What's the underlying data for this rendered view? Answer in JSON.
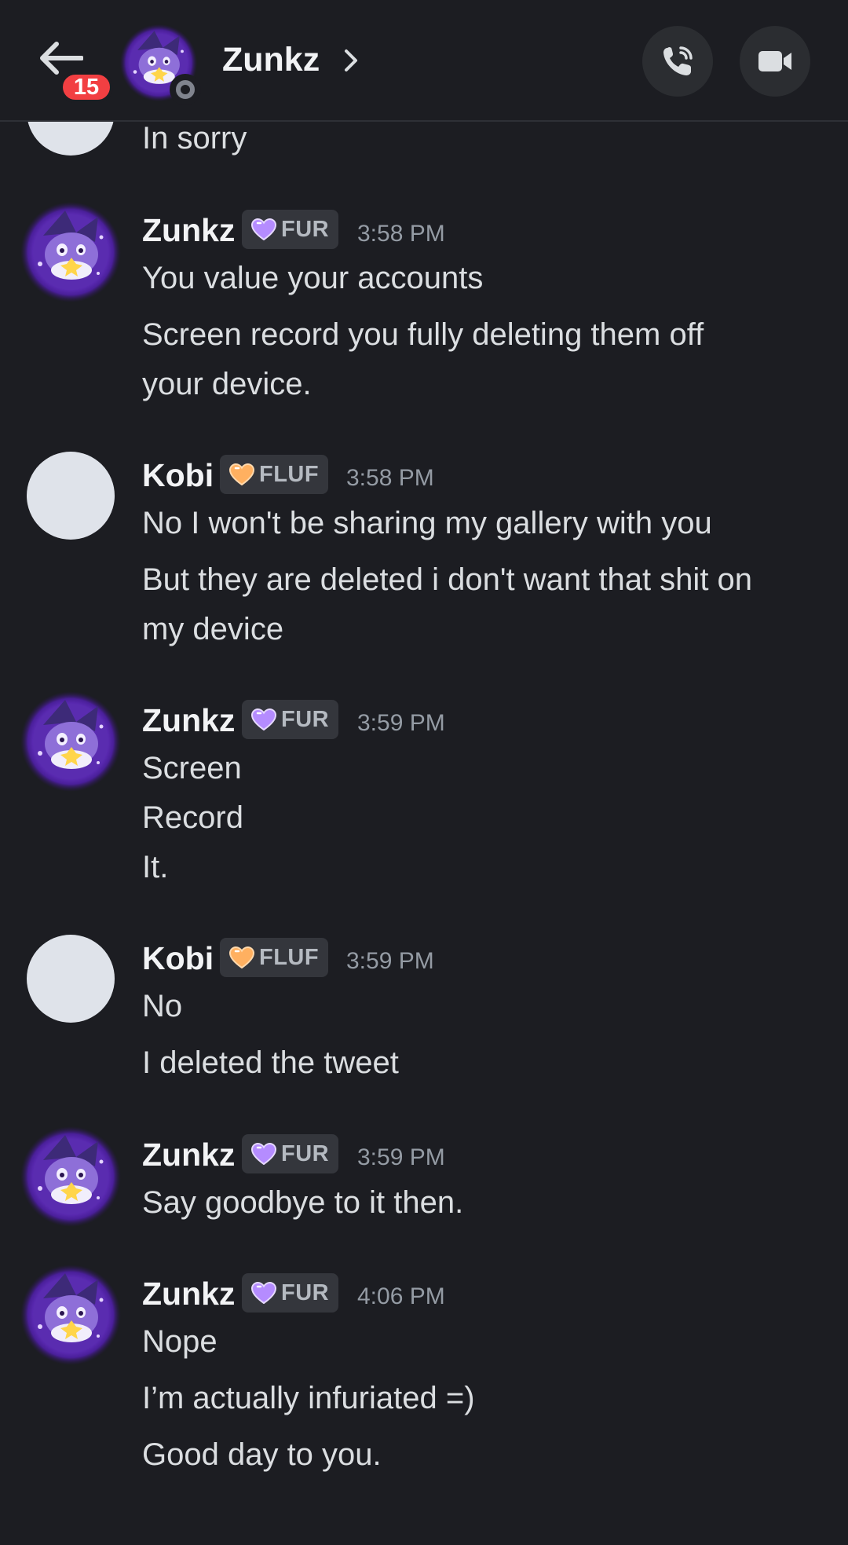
{
  "header": {
    "title": "Zunkz",
    "unread_count": "15",
    "back_icon": "arrow-left-icon",
    "call_icon": "phone-icon",
    "video_icon": "video-camera-icon",
    "status": "offline"
  },
  "colors": {
    "background": "#1c1d22",
    "badge": "#f23f42",
    "fur_heart": "#b58cff",
    "fluf_heart": "#ffb060",
    "text": "#dbdee1",
    "timestamp": "#949ba4"
  },
  "messages": [
    {
      "author": "",
      "lines": [
        "In sorry"
      ]
    },
    {
      "author": "Zunkz",
      "tag": "FUR",
      "time": "3:58 PM",
      "lines": [
        "You value your accounts",
        "Screen record you fully deleting them off",
        "your device."
      ]
    },
    {
      "author": "Kobi",
      "tag": "FLUF",
      "time": "3:58 PM",
      "lines": [
        "No I won't be sharing my gallery with you",
        "But they are deleted i don't want that shit on",
        "my device"
      ]
    },
    {
      "author": "Zunkz",
      "tag": "FUR",
      "time": "3:59 PM",
      "lines": [
        "Screen",
        "Record",
        "It."
      ]
    },
    {
      "author": "Kobi",
      "tag": "FLUF",
      "time": "3:59 PM",
      "lines": [
        "No",
        "I deleted the tweet"
      ]
    },
    {
      "author": "Zunkz",
      "tag": "FUR",
      "time": "3:59 PM",
      "lines": [
        "Say goodbye to it then."
      ]
    },
    {
      "author": "Zunkz",
      "tag": "FUR",
      "time": "4:06 PM",
      "lines": [
        "Nope",
        "I’m actually infuriated =)",
        "Good day to you."
      ]
    }
  ]
}
